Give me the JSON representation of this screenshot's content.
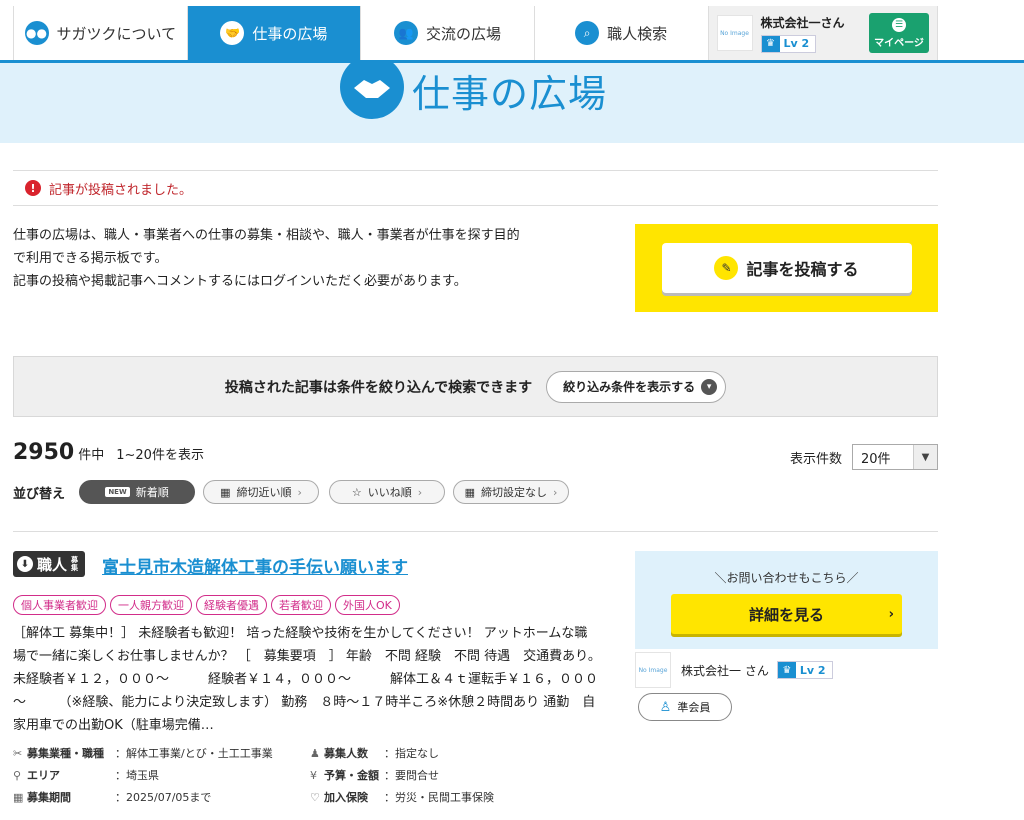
{
  "nav": {
    "about": "サガツクについて",
    "jobs": "仕事の広場",
    "exchange": "交流の広場",
    "search": "職人検索",
    "user_name": "株式会社一さん",
    "level": "Lv 2",
    "mypage": "マイページ",
    "no_image": "No Image"
  },
  "hero": {
    "title": "仕事の広場"
  },
  "alert": {
    "text": "記事が投稿されました。"
  },
  "intro": {
    "line1": "仕事の広場は、職人・事業者への仕事の募集・相談や、職人・事業者が仕事を探す目的",
    "line2": "で利用できる掲示板です。",
    "line3": "記事の投稿や掲載記事へコメントするにはログインいただく必要があります。"
  },
  "post_button": "記事を投稿する",
  "filter": {
    "text": "投稿された記事は条件を絞り込んで検索できます",
    "button": "絞り込み条件を表示する"
  },
  "results": {
    "total": "2950",
    "unit": "件中",
    "range": "1~20件を表示",
    "per_page_label": "表示件数",
    "per_page_value": "20件"
  },
  "sort": {
    "label": "並び替え",
    "new_badge": "NEW",
    "options": [
      "新着順",
      "締切近い順",
      "いいね順",
      "締切設定なし"
    ]
  },
  "post": {
    "badge": "職人",
    "badge_sub": "募集",
    "title": "富士見市木造解体工事の手伝い願います",
    "tags": [
      "個人事業者歓迎",
      "一人親方歓迎",
      "経験者優遇",
      "若者歓迎",
      "外国人OK"
    ],
    "body": "［解体工 募集中！］ 未経験者も歓迎！ 培った経験や技術を生かしてください！ アットホームな職場で一緒に楽しくお仕事しませんか？ ［　募集要項　］ 年齢　不問 経験　不問 待遇　交通費あり。　　　未経験者￥１２，０００～　　　経験者￥１４，０００～　　　解体工＆４ｔ運転手￥１６，０００～　　　（※経験、能力により決定致します） 勤務　８時～１７時半ころ※休憩２時間あり 通勤　自家用車での出勤OK（駐車場完備…",
    "meta": {
      "industry_label": "募集業種・職種",
      "industry_value": "：解体工事業/とび・土工工事業",
      "area_label": "エリア",
      "area_value": "：埼玉県",
      "period_label": "募集期間",
      "period_value": "：2025/07/05まで",
      "count_label": "募集人数",
      "count_value": "：指定なし",
      "budget_label": "予算・金額",
      "budget_value": "：要問合せ",
      "insurance_label": "加入保険",
      "insurance_value": "：労災・民間工事保険"
    }
  },
  "side": {
    "contact": "＼お問い合わせもこちら／",
    "detail": "詳細を見る",
    "user": "株式会社一 さん",
    "level": "Lv 2",
    "member": "準会員"
  },
  "colors": {
    "brand": "#1a8fd1",
    "accent": "#ffe500",
    "alert": "#d9232d",
    "tag": "#d22d8a",
    "mypage": "#1aa16f"
  }
}
